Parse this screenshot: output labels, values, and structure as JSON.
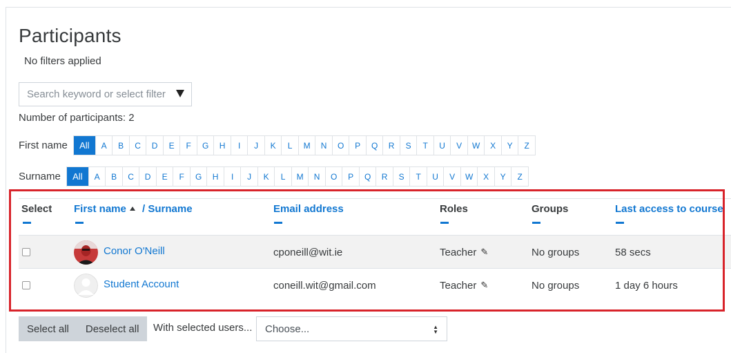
{
  "page": {
    "title": "Participants",
    "filters_status": "No filters applied",
    "search_placeholder": "Search keyword or select filter",
    "participant_count": "Number of participants: 2"
  },
  "initials_bar": {
    "first_name_label": "First name",
    "surname_label": "Surname",
    "all_label": "All",
    "letters": [
      "A",
      "B",
      "C",
      "D",
      "E",
      "F",
      "G",
      "H",
      "I",
      "J",
      "K",
      "L",
      "M",
      "N",
      "O",
      "P",
      "Q",
      "R",
      "S",
      "T",
      "U",
      "V",
      "W",
      "X",
      "Y",
      "Z"
    ]
  },
  "table": {
    "headers": {
      "select": "Select",
      "first_name": "First name",
      "surname": "/ Surname",
      "email": "Email address",
      "roles": "Roles",
      "groups": "Groups",
      "last_access": "Last access to course"
    },
    "rows": [
      {
        "name": "Conor O'Neill",
        "email": "cponeill@wit.ie",
        "role": "Teacher",
        "groups": "No groups",
        "last_access": "58 secs",
        "avatar": "user-photo"
      },
      {
        "name": "Student Account",
        "email": "coneill.wit@gmail.com",
        "role": "Teacher",
        "groups": "No groups",
        "last_access": "1 day 6 hours",
        "avatar": "default-avatar"
      }
    ]
  },
  "bulk_actions": {
    "select_all": "Select all",
    "deselect_all": "Deselect all",
    "with_selected": "With selected users...",
    "choose": "Choose..."
  },
  "colors": {
    "accent": "#1177d1",
    "highlight": "#d8232a"
  }
}
